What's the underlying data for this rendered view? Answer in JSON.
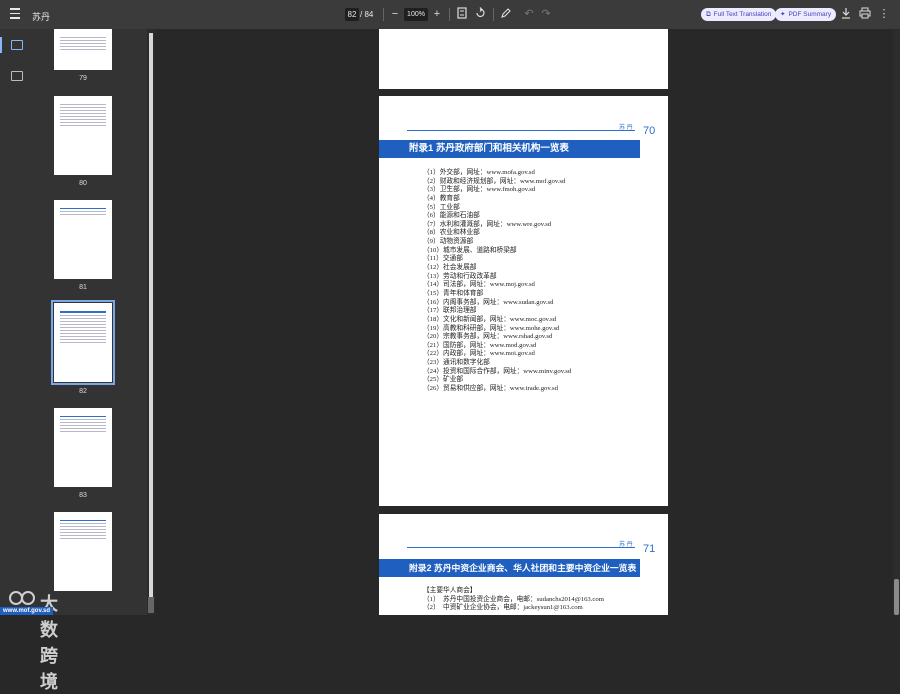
{
  "toolbar": {
    "title": "苏丹",
    "current_page": "82",
    "total_pages": "/ 84",
    "zoom": "100%",
    "full_text_translation": "Full Text Translation",
    "pdf_summary": "PDF Summary"
  },
  "thumbnails": [
    {
      "num": "79"
    },
    {
      "num": "80"
    },
    {
      "num": "81"
    },
    {
      "num": "82"
    },
    {
      "num": "83"
    },
    {
      "num": ""
    }
  ],
  "page70": {
    "header_label": "苏 丹",
    "page_number": "70",
    "banner": "附录1  苏丹政府部门和相关机构一览表",
    "entries": [
      "（1）外交部，网址：www.mofa.gov.sd",
      "（2）财政和经济规划部，网址：www.mof.gov.sd",
      "（3）卫生部，网址：www.fmoh.gov.sd",
      "（4）教育部",
      "（5）工业部",
      "（6）能源和石油部",
      "（7）水利和灌溉部，网址：www.wre.gov.sd",
      "（8）农业和林业部",
      "（9）动物资源部",
      "（10）城市发展、道路和桥梁部",
      "（11）交通部",
      "（12）社会发展部",
      "（13）劳动和行政改革部",
      "（14）司法部，网址：www.moj.gov.sd",
      "（15）青年和体育部",
      "（16）内阁事务部，网址：www.sudan.gov.sd",
      "（17）联邦治理部",
      "（18）文化和新闻部，网址：www.moc.gov.sd",
      "（19）高教和科研部，网址：www.mohe.gov.sd",
      "（20）宗教事务部，网址：www.rshad.gov.sd",
      "（21）国防部，网址：www.mod.gov.sd",
      "（22）内政部，网址：www.moi.gov.sd",
      "（23）通讯和数字化部",
      "（24）投资和国际合作部，网址：www.minv.gov.sd",
      "（25）矿业部",
      "（26）贸易和供应部，网址：www.trade.gov.sd"
    ]
  },
  "page71": {
    "header_label": "苏 丹",
    "page_number": "71",
    "banner": "附录2  苏丹中资企业商会、华人社团和主要中资企业一览表",
    "entries": [
      "【主要华人商会】",
      "（1）　苏丹中国投资企业商会，电邮：sudanchs2014@163.com",
      "（2）　中资矿业企业协会，电邮：jackeysun1@163.com"
    ]
  },
  "watermark": {
    "name": "大数跨境",
    "url": "www.mof.gov.sd"
  }
}
